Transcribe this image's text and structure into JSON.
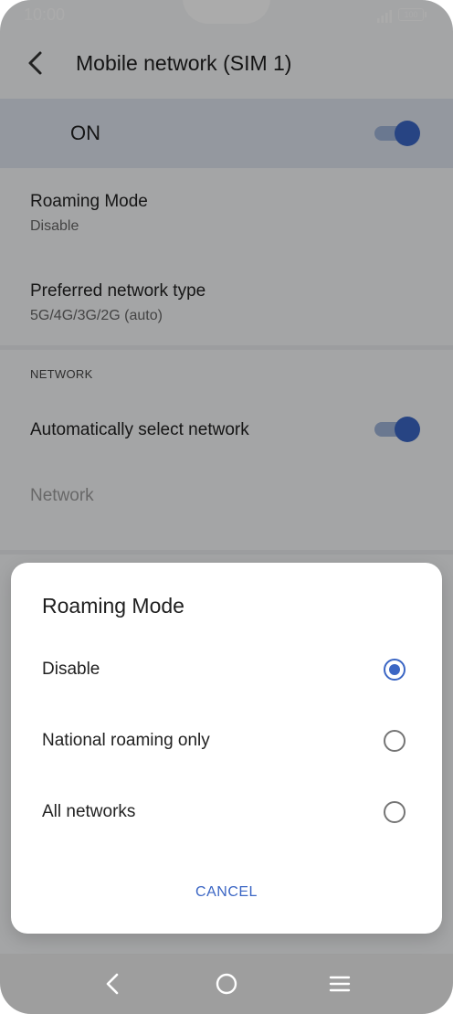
{
  "status_bar": {
    "time": "10:00",
    "battery": "100"
  },
  "app_bar": {
    "title": "Mobile network (SIM 1)"
  },
  "master_switch": {
    "label": "ON",
    "state": "on"
  },
  "settings": {
    "roaming_mode": {
      "title": "Roaming Mode",
      "summary": "Disable"
    },
    "preferred_network": {
      "title": "Preferred network type",
      "summary": "5G/4G/3G/2G (auto)"
    },
    "network_section": {
      "header": "NETWORK"
    },
    "auto_select": {
      "title": "Automatically select network",
      "state": "on"
    },
    "network": {
      "title": "Network"
    }
  },
  "dialog": {
    "title": "Roaming Mode",
    "options": [
      {
        "label": "Disable",
        "selected": true
      },
      {
        "label": "National roaming only",
        "selected": false
      },
      {
        "label": "All networks",
        "selected": false
      }
    ],
    "cancel_label": "CANCEL"
  },
  "colors": {
    "accent": "#3b66c4",
    "switch_track": "#9fb3d7",
    "highlight_row": "#dde3ee"
  },
  "nav_bar": {
    "icons": [
      "back-icon",
      "home-icon",
      "menu-icon"
    ]
  }
}
